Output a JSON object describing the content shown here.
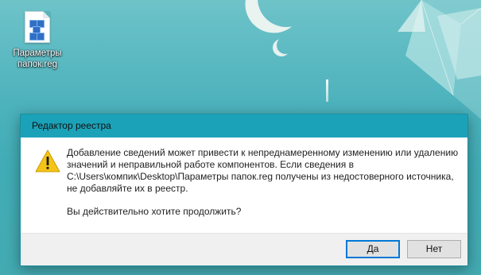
{
  "desktop": {
    "icon": {
      "name": "reg-file-icon",
      "label_line1": "Параметры",
      "label_line2": "папок.reg"
    }
  },
  "dialog": {
    "title": "Редактор реестра",
    "icon": "warning-icon",
    "message_lines": [
      "Добавление сведений может привести к непреднамеренному изменению или удалению",
      "значений и неправильной работе компонентов. Если сведения в",
      "C:\\Users\\компик\\Desktop\\Параметры папок.reg получены из недостоверного источника,",
      "не добавляйте их в реестр."
    ],
    "question": "Вы действительно хотите продолжить?",
    "buttons": {
      "yes": "Да",
      "no": "Нет"
    }
  },
  "colors": {
    "titlebar": "#1ba2b8",
    "accent": "#0078d7",
    "warning": "#f6c417"
  }
}
